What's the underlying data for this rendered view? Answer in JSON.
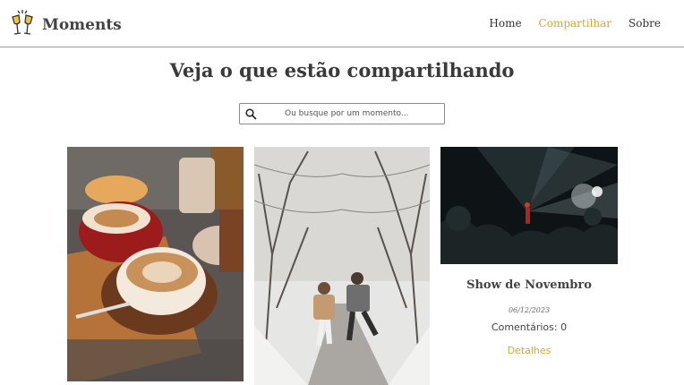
{
  "brand": {
    "name": "Moments",
    "logo_icon": "champagne-toast-icon"
  },
  "nav": {
    "home": "Home",
    "share": "Compartilhar",
    "about": "Sobre",
    "accent": "#d8a82e"
  },
  "page": {
    "title": "Veja o que estão compartilhando"
  },
  "search": {
    "placeholder": "Ou busque por um momento...",
    "value": "",
    "icon": "search-icon"
  },
  "cards": [
    {
      "image": "coffee-cups-photo"
    },
    {
      "image": "snowy-road-couple-photo"
    },
    {
      "image": "concert-stage-photo",
      "title": "Show de Novembro",
      "date": "06/12/2023",
      "comments": "Comentários: 0",
      "link": "Detalhes"
    }
  ]
}
